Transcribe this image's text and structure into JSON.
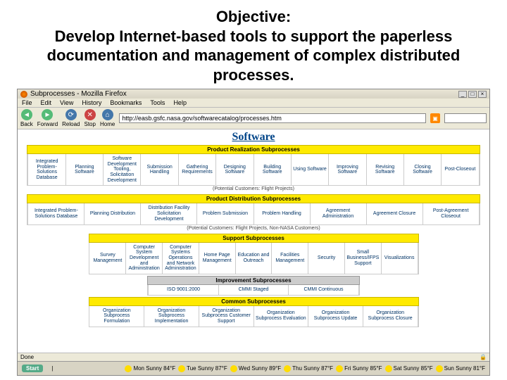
{
  "slide": {
    "objective_label": "Objective:",
    "objective_text": "Develop Internet-based tools to support the paperless documentation and management of complex distributed processes."
  },
  "browser": {
    "title": "Subprocesses - Mozilla Firefox",
    "menu": [
      "File",
      "Edit",
      "View",
      "History",
      "Bookmarks",
      "Tools",
      "Help"
    ],
    "toolbar": {
      "back": "Back",
      "forward": "Forward",
      "reload": "Reload",
      "stop": "Stop",
      "home": "Home"
    },
    "url": "http://easb.gsfc.nasa.gov/softwarecatalog/processes.htm",
    "page_title": "Software",
    "sections": [
      {
        "title": "Product Realization Subprocesses",
        "rows": [
          [
            "Integrated Problem-Solutions Database",
            "Planning Software",
            "Software Development Tooling, Solicitation Development",
            "Submission Handling",
            "Gathering Requirements",
            "Designing Software",
            "Building Software",
            "Using Software",
            "Improving Software",
            "Revising Software",
            "Closing Software",
            "Post-Closeout"
          ]
        ],
        "sub": "(Potential Customers: Flight Projects)"
      },
      {
        "title": "Product Distribution Subprocesses",
        "rows": [
          [
            "Integrated Problem-Solutions Database",
            "Planning Distribution",
            "Distribution Facility Solicitation Development",
            "Problem Submission",
            "Problem Handling",
            "Agreement Administration",
            "Agreement Closure",
            "Post-Agreement Closeout"
          ]
        ],
        "sub": "(Potential Customers: Flight Projects, Non-NASA Customers)"
      },
      {
        "title": "Support Subprocesses",
        "rows": [
          [
            "Survey Management",
            "Computer System Development and Administration",
            "Computer Systems Operations and Network Administration",
            "Home Page Management",
            "Education and Outreach",
            "Facilities Management",
            "Security",
            "Small Business/IFPS Support",
            "Visualizations"
          ]
        ],
        "sub": ""
      },
      {
        "title": "Improvement Subprocesses",
        "grey": true,
        "rows": [
          [
            "ISO 9001:2000",
            "CMMI Staged",
            "CMMI Continuous"
          ]
        ],
        "sub": ""
      },
      {
        "title": "Common Subprocesses",
        "rows": [
          [
            "Organization Subprocess Formulation",
            "Organization Subprocess Implementation",
            "Organization Subprocess Customer Support",
            "Organization Subprocess Evaluation",
            "Organization Subprocess Update",
            "Organization Subprocess Closure"
          ]
        ],
        "sub": ""
      }
    ],
    "status": "Done"
  },
  "taskbar": {
    "start": "Start",
    "weather": [
      {
        "day": "Mon",
        "temp": "Sunny 84°F"
      },
      {
        "day": "Tue",
        "temp": "Sunny 87°F"
      },
      {
        "day": "Wed",
        "temp": "Sunny 89°F"
      },
      {
        "day": "Thu",
        "temp": "Sunny 87°F"
      },
      {
        "day": "Fri",
        "temp": "Sunny 85°F"
      },
      {
        "day": "Sat",
        "temp": "Sunny 85°F"
      },
      {
        "day": "Sun",
        "temp": "Sunny 81°F"
      }
    ]
  }
}
